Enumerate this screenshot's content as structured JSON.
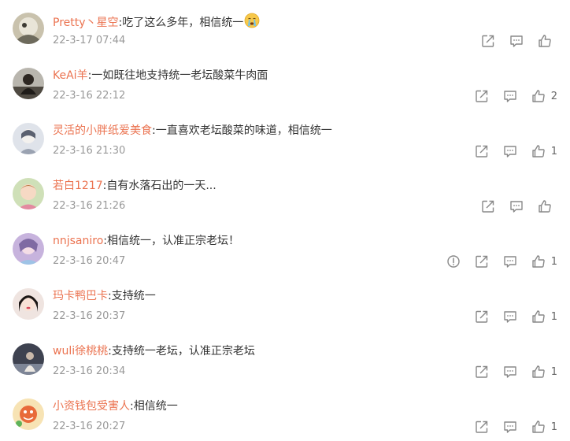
{
  "colors": {
    "username": "#eb7350",
    "text": "#333333",
    "time": "#999999",
    "icon": "#888888"
  },
  "icons": {
    "repost": "share-arrow-icon",
    "comment": "comment-bubble-icon",
    "like": "thumbs-up-icon",
    "report": "report-exclamation-icon",
    "emoji": "crying-face-emoji-icon"
  },
  "comments": [
    {
      "username": "Pretty丶星空",
      "text": ":吃了这么多年，相信统一",
      "time": "22-3-17 07:44",
      "likes": ""
    },
    {
      "username": "KeAi羊",
      "text": ":一如既往地支持统一老坛酸菜牛肉面",
      "time": "22-3-16 22:12",
      "likes": "2"
    },
    {
      "username": "灵活的小胖纸爱美食",
      "text": ":一直喜欢老坛酸菜的味道，相信统一",
      "time": "22-3-16 21:30",
      "likes": "1"
    },
    {
      "username": "若白1217",
      "text": ":自有水落石出的一天...",
      "time": "22-3-16 21:26",
      "likes": ""
    },
    {
      "username": "nnjsaniro",
      "text": ":相信统一，认准正宗老坛！",
      "time": "22-3-16 20:47",
      "likes": "1"
    },
    {
      "username": "玛卡鸭巴卡",
      "text": ":支持统一",
      "time": "22-3-16 20:37",
      "likes": "1"
    },
    {
      "username": "wuli徐桃桃",
      "text": ":支持统一老坛，认准正宗老坛",
      "time": "22-3-16 20:34",
      "likes": "1"
    },
    {
      "username": "小资钱包受害人",
      "text": ":相信统一",
      "time": "22-3-16 20:27",
      "likes": "1"
    }
  ]
}
